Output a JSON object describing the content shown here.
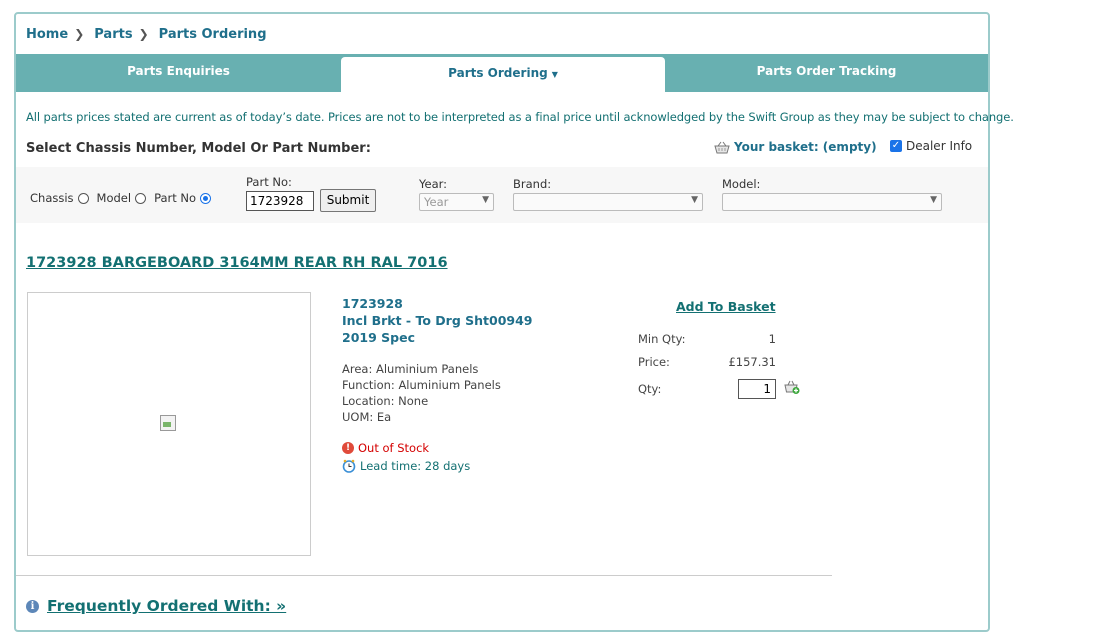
{
  "breadcrumb": {
    "items": [
      "Home",
      "Parts",
      "Parts Ordering"
    ]
  },
  "tabs": [
    {
      "label": "Parts Enquiries",
      "active": false
    },
    {
      "label": "Parts Ordering",
      "active": true
    },
    {
      "label": "Parts Order Tracking",
      "active": false
    }
  ],
  "notice": "All parts prices stated are current as of today’s date. Prices are not to be interpreted as a final price until acknowledged by the Swift Group as they may be subject to change.",
  "select_heading": "Select Chassis Number, Model Or Part Number:",
  "basket": {
    "label": "Your basket: (empty)"
  },
  "dealer_info": {
    "label": "Dealer Info",
    "checked": true
  },
  "search": {
    "modes": [
      {
        "label": "Chassis",
        "selected": false
      },
      {
        "label": "Model",
        "selected": false
      },
      {
        "label": "Part No",
        "selected": true
      }
    ],
    "part_no_label": "Part No:",
    "part_no_value": "1723928",
    "submit_label": "Submit",
    "year_label": "Year:",
    "year_value": "Year",
    "brand_label": "Brand:",
    "brand_value": "",
    "model_label": "Model:",
    "model_value": ""
  },
  "part": {
    "title": "1723928 BARGEBOARD 3164MM REAR RH RAL 7016",
    "number": "1723928",
    "desc1": "Incl Brkt - To Drg Sht00949",
    "desc2": "2019 Spec",
    "area": "Area: Aluminium Panels",
    "function": "Function: Aluminium Panels",
    "location": "Location: None",
    "uom": "UOM: Ea",
    "stock_status": "Out of Stock",
    "lead_time": "Lead time: 28 days"
  },
  "ordering": {
    "add_to_basket": "Add To Basket",
    "min_qty_label": "Min Qty:",
    "min_qty_value": "1",
    "price_label": "Price:",
    "price_value": "£157.31",
    "qty_label": "Qty:",
    "qty_value": "1"
  },
  "frequently_ordered": "Frequently Ordered With: »",
  "colors": {
    "teal": "#68b0b1",
    "link": "#1f6f8b",
    "dark_teal": "#137072",
    "error": "#d40000"
  }
}
